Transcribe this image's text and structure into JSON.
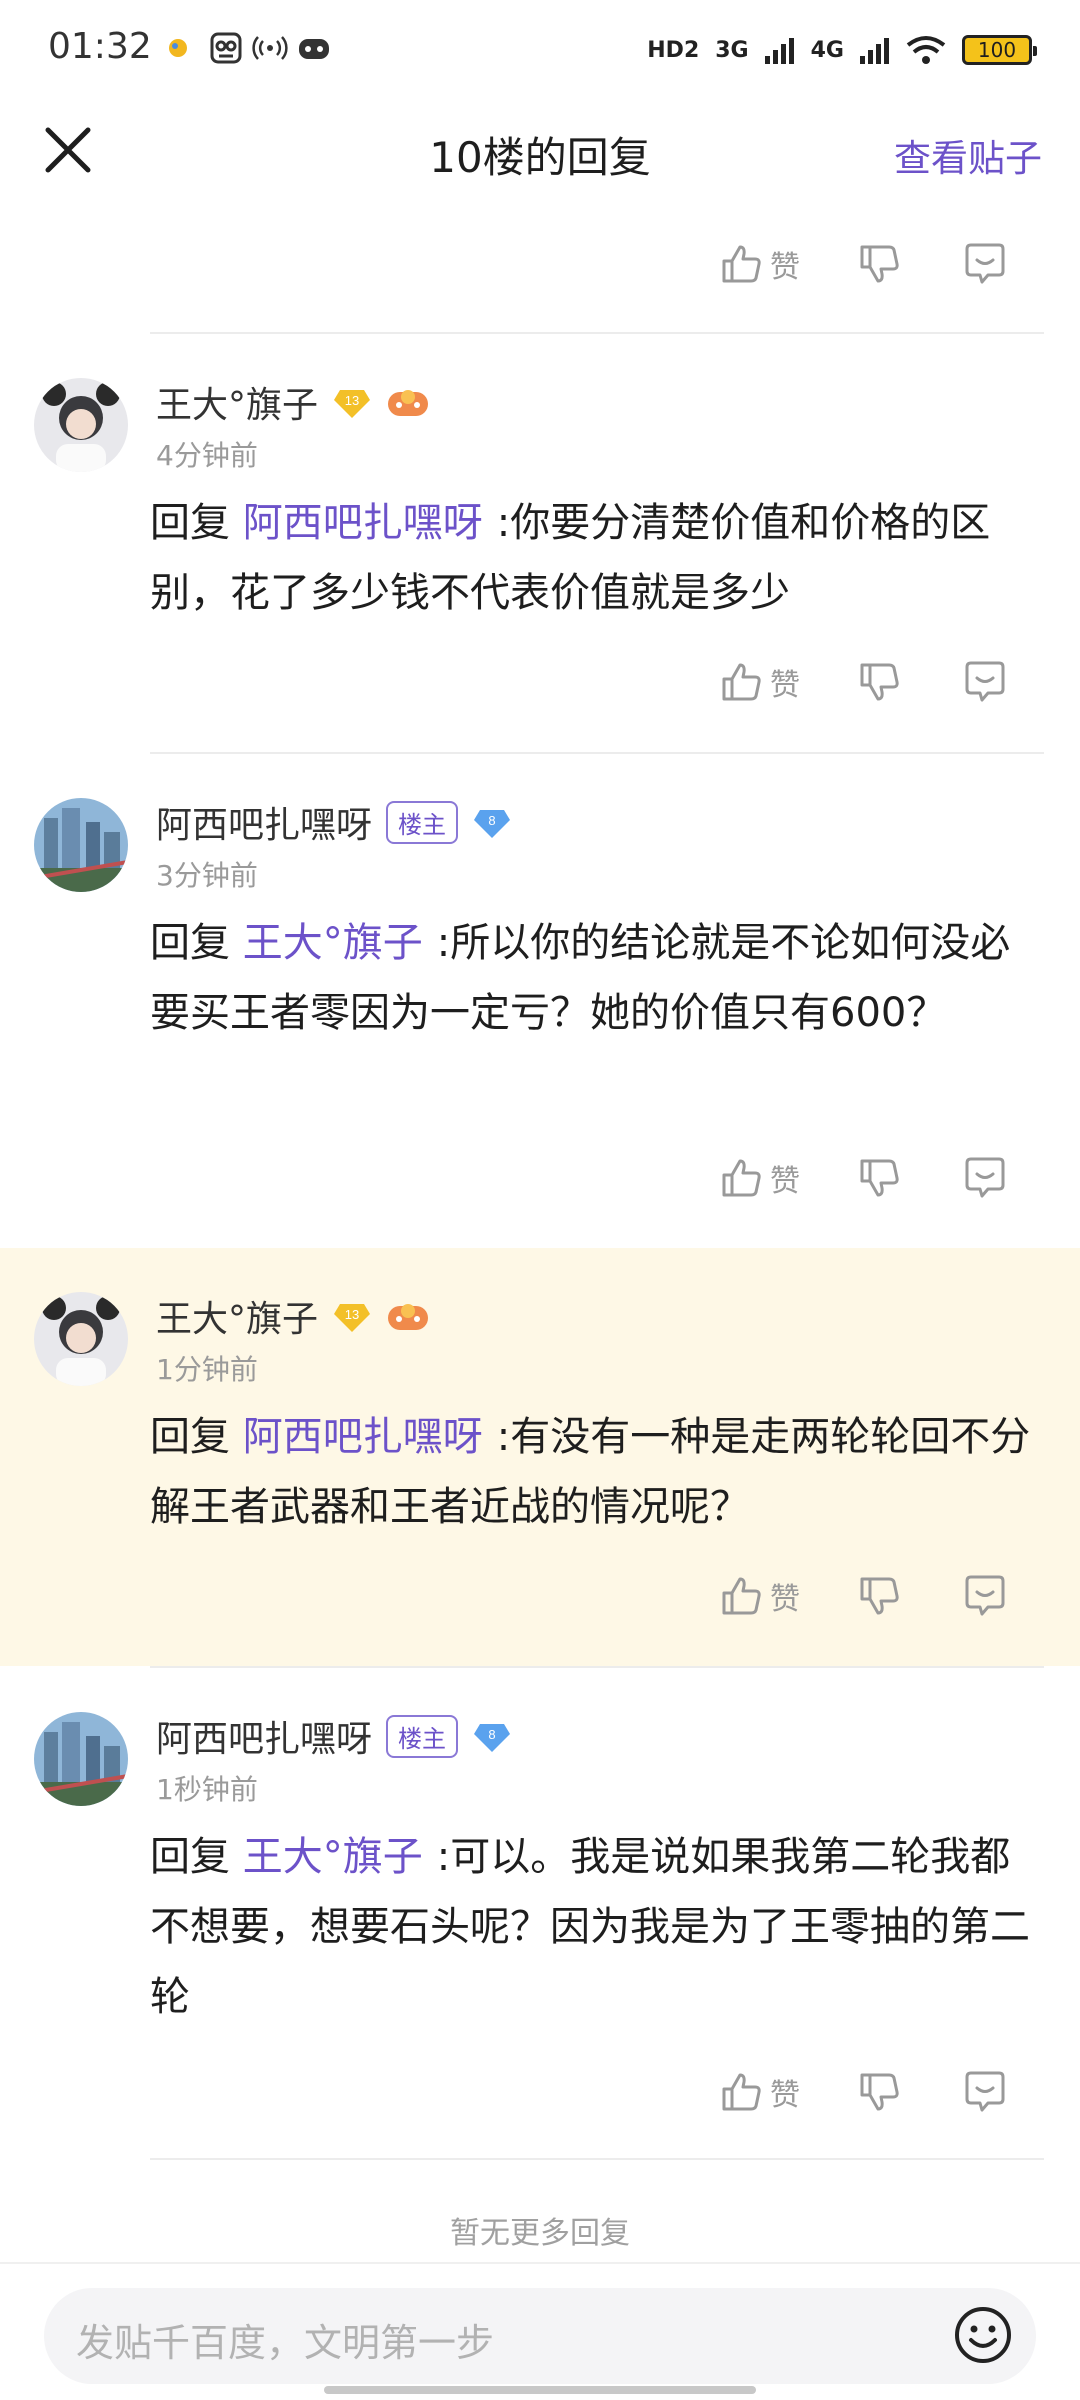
{
  "status_bar": {
    "time": "01:32",
    "hd": "HD2",
    "net1": "3G",
    "net2": "4G",
    "battery": "100"
  },
  "header": {
    "title": "10楼的回复",
    "view_post": "查看贴子"
  },
  "actions": {
    "like_label": "赞"
  },
  "comments": [
    {
      "user": "王大°旗子",
      "level": "13",
      "time": "4分钟前",
      "reply_prefix": "回复",
      "mention": "阿西吧扎嘿呀",
      "text": ":你要分清楚价值和价格的区别，花了多少钱不代表价值就是多少"
    },
    {
      "user": "阿西吧扎嘿呀",
      "owner_tag": "楼主",
      "level": "8",
      "time": "3分钟前",
      "reply_prefix": "回复",
      "mention": "王大°旗子",
      "text": ":所以你的结论就是不论如何没必要买王者零因为一定亏？她的价值只有600？"
    },
    {
      "user": "王大°旗子",
      "level": "13",
      "time": "1分钟前",
      "reply_prefix": "回复",
      "mention": "阿西吧扎嘿呀",
      "text": ":有没有一种是走两轮轮回不分解王者武器和王者近战的情况呢？"
    },
    {
      "user": "阿西吧扎嘿呀",
      "owner_tag": "楼主",
      "level": "8",
      "time": "1秒钟前",
      "reply_prefix": "回复",
      "mention": "王大°旗子",
      "text": ":可以。我是说如果我第二轮我都不想要，想要石头呢？因为我是为了王零抽的第二轮"
    }
  ],
  "no_more": "暂无更多回复",
  "input": {
    "placeholder": "发贴千百度，文明第一步"
  },
  "colors": {
    "accent": "#6c52c9",
    "highlight": "#fef8e6"
  }
}
